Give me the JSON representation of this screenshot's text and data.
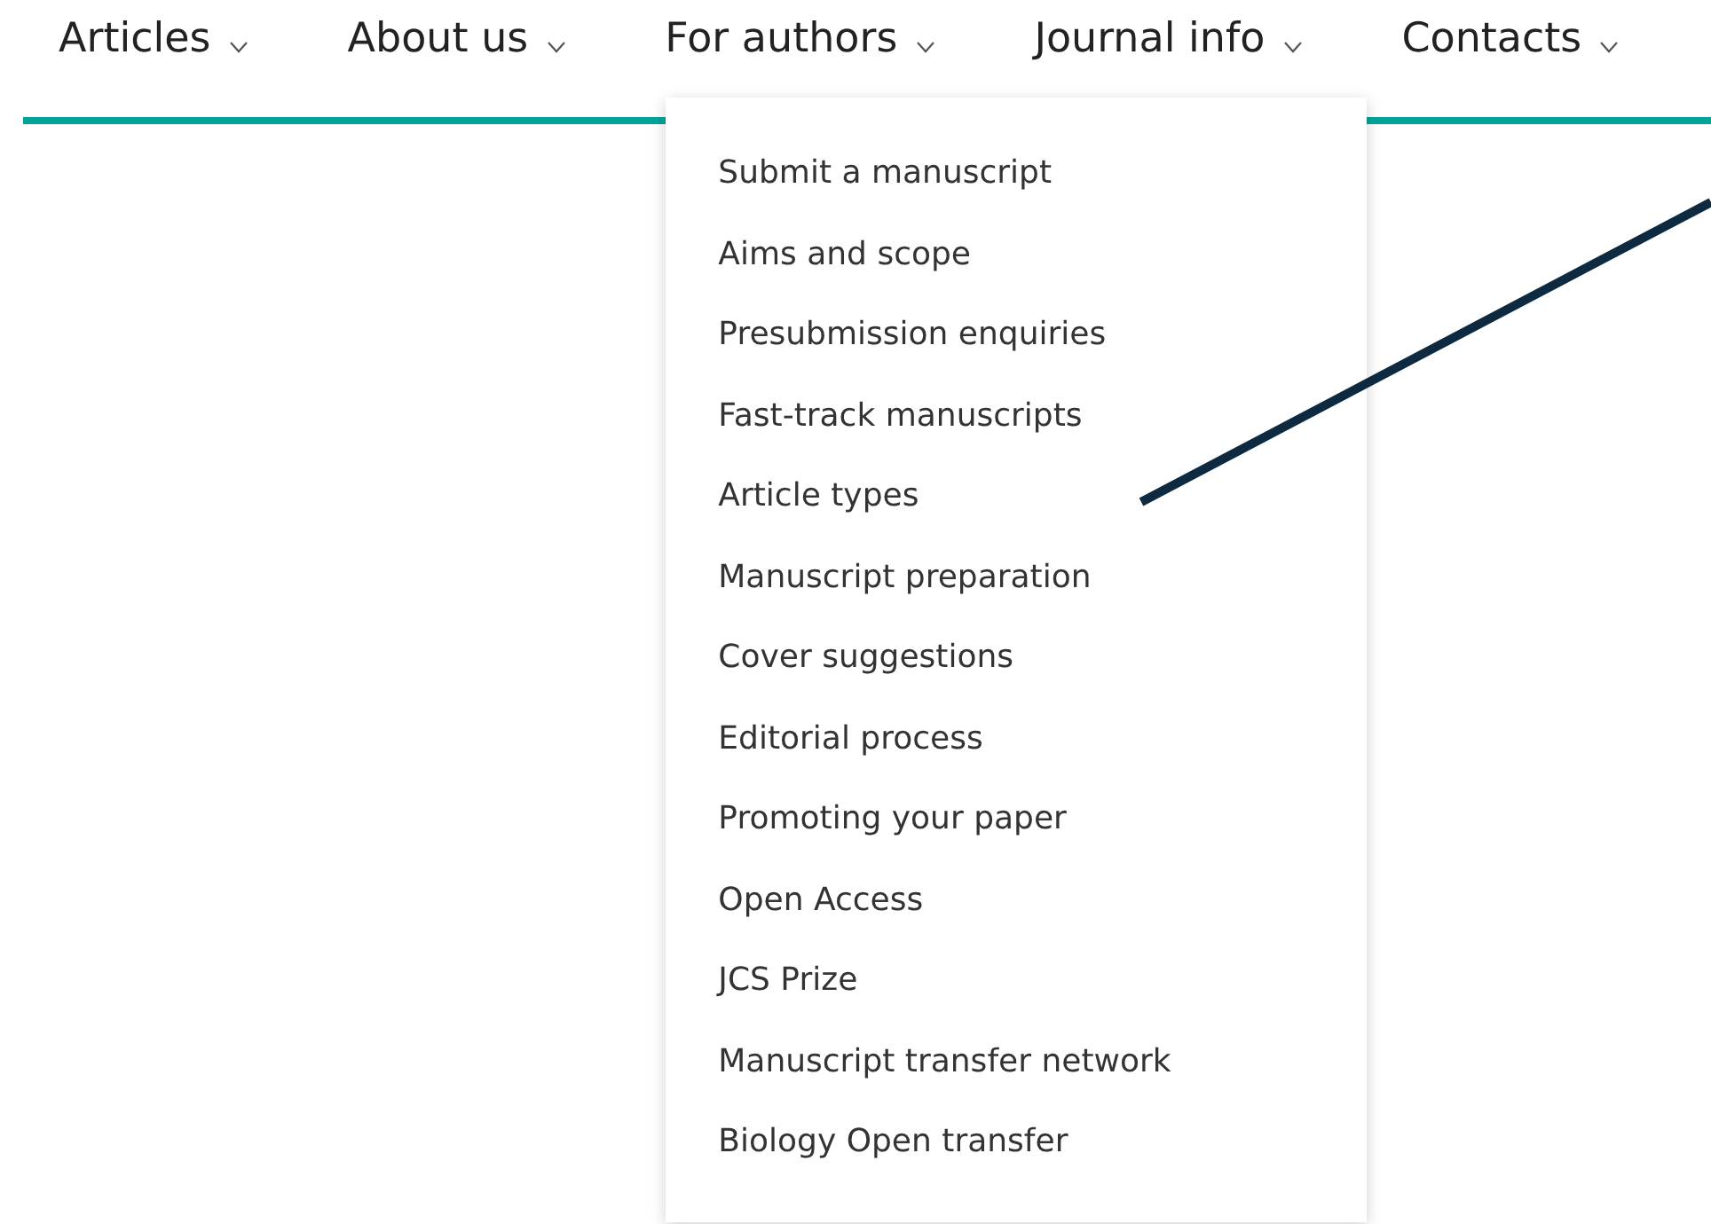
{
  "nav": [
    {
      "label": "Articles"
    },
    {
      "label": "About us"
    },
    {
      "label": "For authors",
      "menu": [
        "Submit a manuscript",
        "Aims and scope",
        "Presubmission enquiries",
        "Fast-track manuscripts",
        "Article types",
        "Manuscript preparation",
        "Cover suggestions",
        "Editorial process",
        "Promoting your paper",
        "Open Access",
        "JCS Prize",
        "Manuscript transfer network",
        "Biology Open transfer"
      ]
    },
    {
      "label": "Journal info"
    },
    {
      "label": "Contacts"
    }
  ]
}
